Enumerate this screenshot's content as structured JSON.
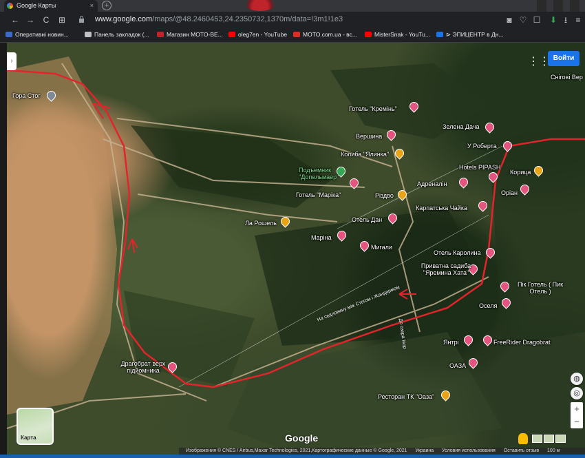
{
  "browser": {
    "tab_title": "Google Карты",
    "close_icon": "×",
    "newtab_icon": "+",
    "url_host": "www.google.com",
    "url_path": "/maps/@48.2460453,24.2350732,1370m/data=!3m1!1e3",
    "nav": {
      "back": "←",
      "forward": "→",
      "reload": "C",
      "apps": "⊞"
    },
    "bookmarks": [
      {
        "label": "Оперативні новин...",
        "color": "#3c6cc9"
      },
      {
        "label": "Панель закладок (...",
        "color": "#bdc1c6"
      },
      {
        "label": "Магазин MOTO-BE...",
        "color": "#c0242b"
      },
      {
        "label": "oleg7en - YouTube",
        "color": "#ff0000"
      },
      {
        "label": "MOTO.com.ua - вс...",
        "color": "#d93025"
      },
      {
        "label": "MisterSnak - YouTu...",
        "color": "#ff0000"
      },
      {
        "label": "⊳ ЭПИЦЕНТР в Дн...",
        "color": "#1a73e8"
      }
    ]
  },
  "map": {
    "signin_label": "Войти",
    "grid_icon": "⋮⋮",
    "sidebar_toggle": "›",
    "layer_label": "Карта",
    "brand": "Google",
    "zoom_in": "+",
    "zoom_out": "−",
    "places": [
      {
        "id": "gora-stog",
        "name": "Гора Стог",
        "pin": "grey"
      },
      {
        "id": "hotel-kremin",
        "name": "Готель \"Кремінь\"",
        "pin": "pink"
      },
      {
        "id": "vershina",
        "name": "Вершина",
        "pin": "pink"
      },
      {
        "id": "zelena-dacha",
        "name": "Зелена Дача",
        "pin": "pink"
      },
      {
        "id": "koliba",
        "name": "Колиба \"Ялинка\"",
        "pin": "orange"
      },
      {
        "id": "u-roberta",
        "name": "У Роберта",
        "pin": "pink"
      },
      {
        "id": "pidyomnyk",
        "name": "Подъемник \"Допельмаер\"",
        "pin": "green"
      },
      {
        "id": "hotels-pipash",
        "name": "Hotels PIPASH",
        "pin": "pink"
      },
      {
        "id": "korytsa",
        "name": "Корица",
        "pin": "orange"
      },
      {
        "id": "hotel-marika",
        "name": "Готель \"Маріка\"",
        "pin": "pink"
      },
      {
        "id": "adrenalin",
        "name": "Адреналін",
        "pin": "pink"
      },
      {
        "id": "oriyan",
        "name": "Оріан",
        "pin": "pink"
      },
      {
        "id": "rizdvo",
        "name": "Різдво",
        "pin": "orange"
      },
      {
        "id": "karpatska-chaika",
        "name": "Карпатська Чайка",
        "pin": "pink"
      },
      {
        "id": "la-roshel",
        "name": "Ла Рошель",
        "pin": "orange"
      },
      {
        "id": "otel-dan",
        "name": "Отель Дан",
        "pin": "pink"
      },
      {
        "id": "marina",
        "name": "Маріна",
        "pin": "pink"
      },
      {
        "id": "mygaly",
        "name": "Мигали",
        "pin": "pink"
      },
      {
        "id": "otel-karolina",
        "name": "Отель Каролина",
        "pin": "pink"
      },
      {
        "id": "sadyba",
        "name": "Приватна садиба \"Яремина Хата\"",
        "pin": "pink"
      },
      {
        "id": "pik-hotel",
        "name": "Пік Готель ( Пик Отель )",
        "pin": "pink"
      },
      {
        "id": "oselia",
        "name": "Оселя",
        "pin": "pink"
      },
      {
        "id": "yantri",
        "name": "Янтрі",
        "pin": "pink"
      },
      {
        "id": "freerider",
        "name": "FreeRider Dragobrat",
        "pin": "pink"
      },
      {
        "id": "oaza",
        "name": "ОАЗА",
        "pin": "pink"
      },
      {
        "id": "drahobrat",
        "name": "Драгобрат верх підйомника",
        "pin": "pink"
      },
      {
        "id": "restoran-oaza",
        "name": "Ресторан ТК \"Оаза\"",
        "pin": "orange"
      },
      {
        "id": "snihovi",
        "name": "Снігові Вер",
        "pin": "none"
      }
    ],
    "road_labels": [
      "На седловину між Стогом і Жандармом",
      "До озера Івор"
    ],
    "route_color": "#e3242b",
    "footer": {
      "attribution": "Изображения © CNES / Airbus,Maxar Technologies, 2021,Картографические данные © Google, 2021",
      "country": "Украина",
      "terms": "Условия использования",
      "feedback": "Оставить отзыв",
      "scale": "100 м"
    }
  }
}
